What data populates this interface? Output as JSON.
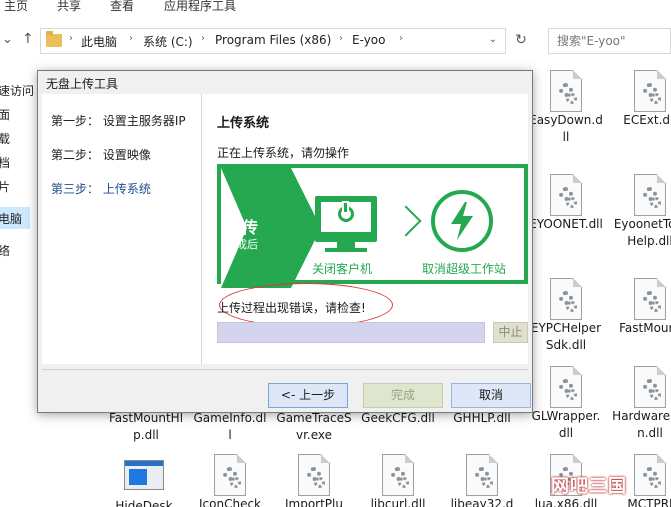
{
  "ribbon": {
    "tabs": [
      {
        "label": "主页"
      },
      {
        "label": "共享"
      },
      {
        "label": "查看"
      },
      {
        "label": "应用程序工具"
      }
    ]
  },
  "address": {
    "crumbs": [
      {
        "label": "此电脑"
      },
      {
        "label": "系统 (C:)"
      },
      {
        "label": "Program Files (x86)"
      },
      {
        "label": "E-yoo"
      }
    ]
  },
  "search": {
    "placeholder": "搜索\"E-yoo\""
  },
  "nav_pane": {
    "items": [
      {
        "label": "速访问"
      },
      {
        "label": "面"
      },
      {
        "label": "载"
      },
      {
        "label": "档"
      },
      {
        "label": "片"
      },
      {
        "label": "电脑"
      },
      {
        "label": "络"
      }
    ]
  },
  "files": [
    {
      "name": "EasyDown.dll",
      "icon": "dll-icon"
    },
    {
      "name": "ECExt.dll",
      "icon": "dll-icon"
    },
    {
      "name": "EYOONET.dll",
      "icon": "dll-icon"
    },
    {
      "name": "EyoonetToolHelp.dll",
      "icon": "dll-icon"
    },
    {
      "name": "EYPCHelperSdk.dll",
      "icon": "dll-icon"
    },
    {
      "name": "FastMount",
      "icon": "dll-icon"
    },
    {
      "name": "FastMountHlp.dll",
      "icon": "dll-icon"
    },
    {
      "name": "GameInfo.dll",
      "icon": "dll-icon"
    },
    {
      "name": "GameTraceSvr.exe",
      "icon": "dll-icon"
    },
    {
      "name": "GeekCFG.dll",
      "icon": "dll-icon"
    },
    {
      "name": "GHHLP.dll",
      "icon": "dll-icon"
    },
    {
      "name": "GLWrapper.dll",
      "icon": "dll-icon"
    },
    {
      "name": "HardwareMon.dll",
      "icon": "dll-icon"
    },
    {
      "name": "HideDesk",
      "icon": "exe-icon"
    },
    {
      "name": "IconCheck",
      "icon": "dll-icon"
    },
    {
      "name": "ImportPlu",
      "icon": "dll-icon"
    },
    {
      "name": "libcurl.dll",
      "icon": "dll-icon"
    },
    {
      "name": "libeay32.d",
      "icon": "dll-icon"
    },
    {
      "name": "lua.x86.dll",
      "icon": "dll-icon"
    },
    {
      "name": "MCTPRI",
      "icon": "dll-icon"
    }
  ],
  "dialog": {
    "title": "无盘上传工具",
    "steps": [
      {
        "label": "第一步：  设置主服务器IP"
      },
      {
        "label": "第二步：  设置映像"
      },
      {
        "label": "第三步：  上传系统"
      }
    ],
    "content_title": "上传系统",
    "status": "正在上传系统，请勿操作",
    "banner": {
      "badge_line1": "上传",
      "badge_line2": "完成后",
      "label_left": "关闭客户机",
      "label_right": "取消超级工作站",
      "accent": "#25a84f"
    },
    "error": "上传过程出现错误，请检查!",
    "progress": 0,
    "stop_label": "中止",
    "buttons": {
      "prev": "<- 上一步",
      "finish": "完成",
      "cancel": "取消"
    }
  },
  "watermark": "网吧三国"
}
